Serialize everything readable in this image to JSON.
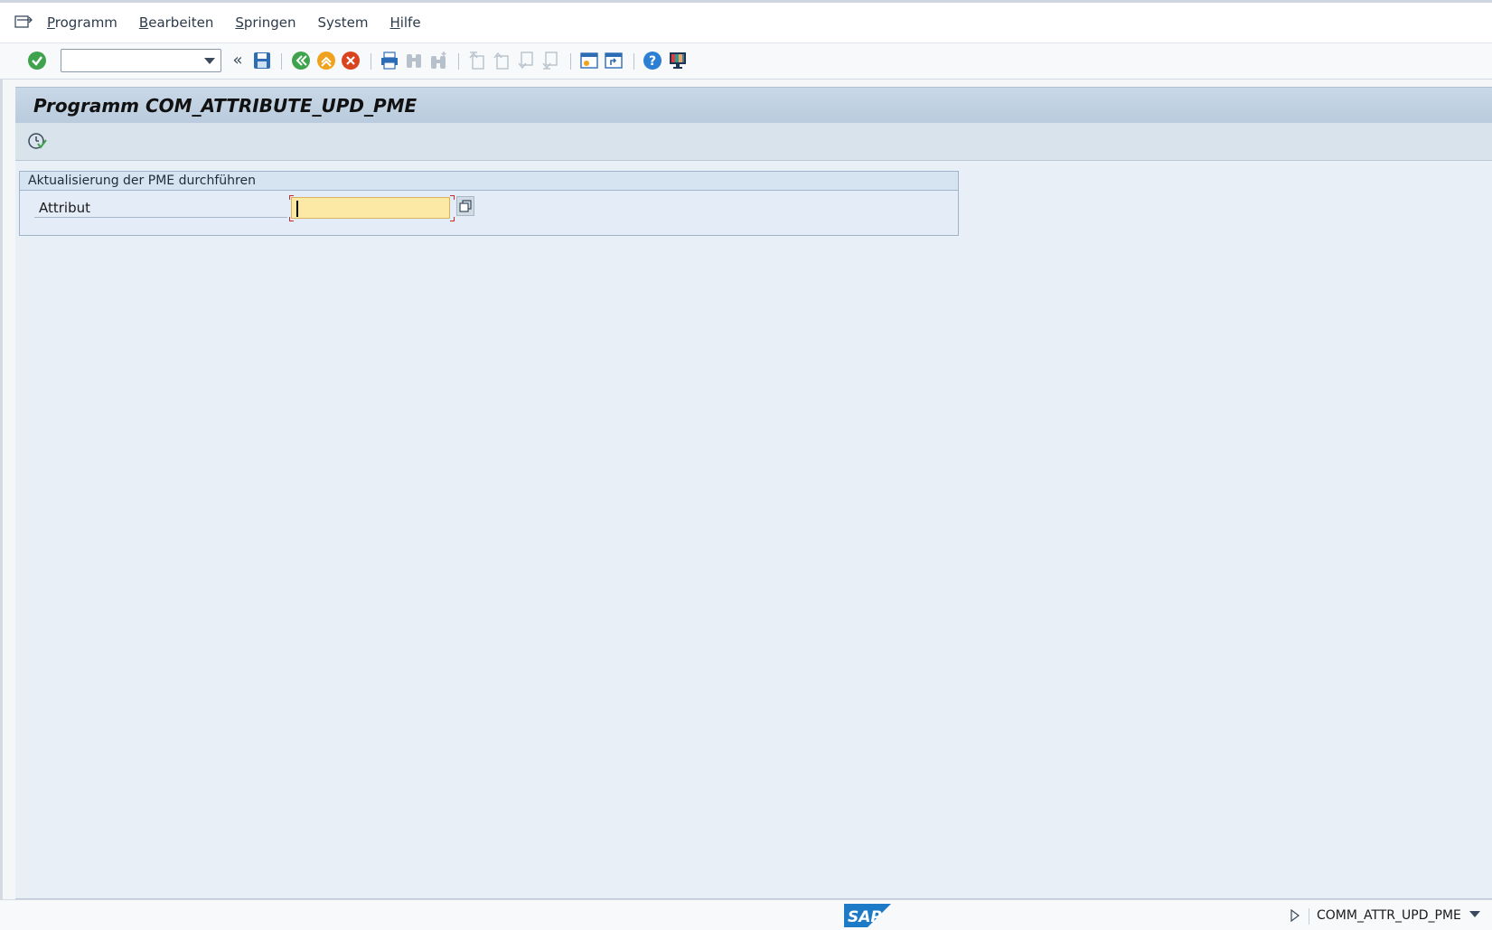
{
  "menubar": {
    "items": [
      {
        "accel": "P",
        "rest": "rogramm"
      },
      {
        "accel": "B",
        "rest": "earbeiten"
      },
      {
        "accel": "S",
        "rest": "pringen"
      },
      {
        "accel": "",
        "rest": "System"
      },
      {
        "accel": "H",
        "rest": "ilfe"
      }
    ]
  },
  "toolbar": {
    "command_value": "",
    "buttons": [
      "enter",
      "back-double",
      "save",
      "back",
      "exit",
      "cancel",
      "print",
      "find",
      "find-next",
      "first-page",
      "previous-page",
      "next-page",
      "last-page",
      "new-session",
      "shortcut",
      "help",
      "customize-layout"
    ]
  },
  "page": {
    "title": "Programm COM_ATTRIBUTE_UPD_PME"
  },
  "groupbox": {
    "title": "Aktualisierung der PME durchführen",
    "field_label": "Attribut",
    "field_value": ""
  },
  "statusbar": {
    "logo": "SAP",
    "transaction": "COMM_ATTR_UPD_PME"
  },
  "colors": {
    "required_field": "#fde9a6",
    "title_bar": "#c9d8e7",
    "content_bg": "#e8eff7",
    "sap_blue": "#1c7ac7"
  }
}
